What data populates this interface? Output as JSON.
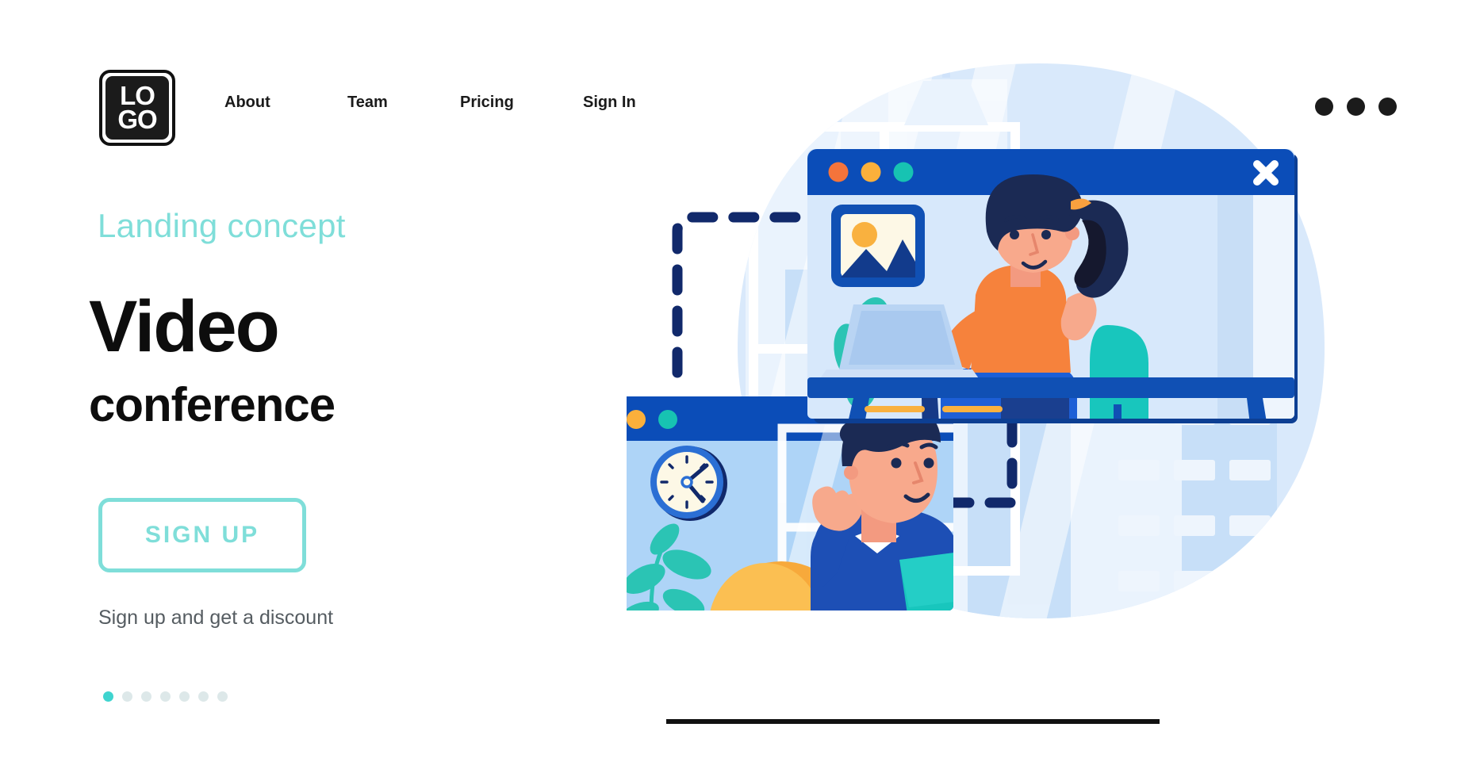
{
  "header": {
    "logo": {
      "line1": "LO",
      "line2": "GO",
      "name": "logo"
    },
    "nav": [
      {
        "label": "About"
      },
      {
        "label": "Team"
      },
      {
        "label": "Pricing"
      },
      {
        "label": "Sign In"
      }
    ],
    "menu_icon": "three-dots-icon"
  },
  "hero": {
    "eyebrow": "Landing concept",
    "title_line1": "Video",
    "title_line2": "conference",
    "cta_label": "SIGN UP",
    "subtext": "Sign up and get a discount",
    "pagination": {
      "total": 7,
      "active": 1
    }
  },
  "illustration": {
    "alt": "Two people on a video conference in browser windows",
    "window_top": {
      "dot_colors": [
        "#f4743b",
        "#fbb03b",
        "#17c3b2"
      ],
      "close_icon": "close-x-icon",
      "content_icon": "image-placeholder-icon",
      "person": "woman-at-desk-with-laptop"
    },
    "window_bottom": {
      "dot_colors": [
        "#f4743b",
        "#fbb03b",
        "#17c3b2"
      ],
      "wall_clock": "wall-clock-icon",
      "person": "man-waving-with-laptop"
    },
    "connector": "dashed-connection-line"
  },
  "colors": {
    "accent_teal": "#7fded9",
    "accent_teal_strong": "#3fd4cf",
    "brand_blue": "#0b4db8",
    "brand_blue_dark": "#11296b",
    "orange": "#f4743b",
    "amber": "#fbb03b",
    "panel_blue": "#aed4f7",
    "panel_light": "#d7e8fb",
    "text_dark": "#0d0d0d",
    "text_muted": "#555c61"
  }
}
